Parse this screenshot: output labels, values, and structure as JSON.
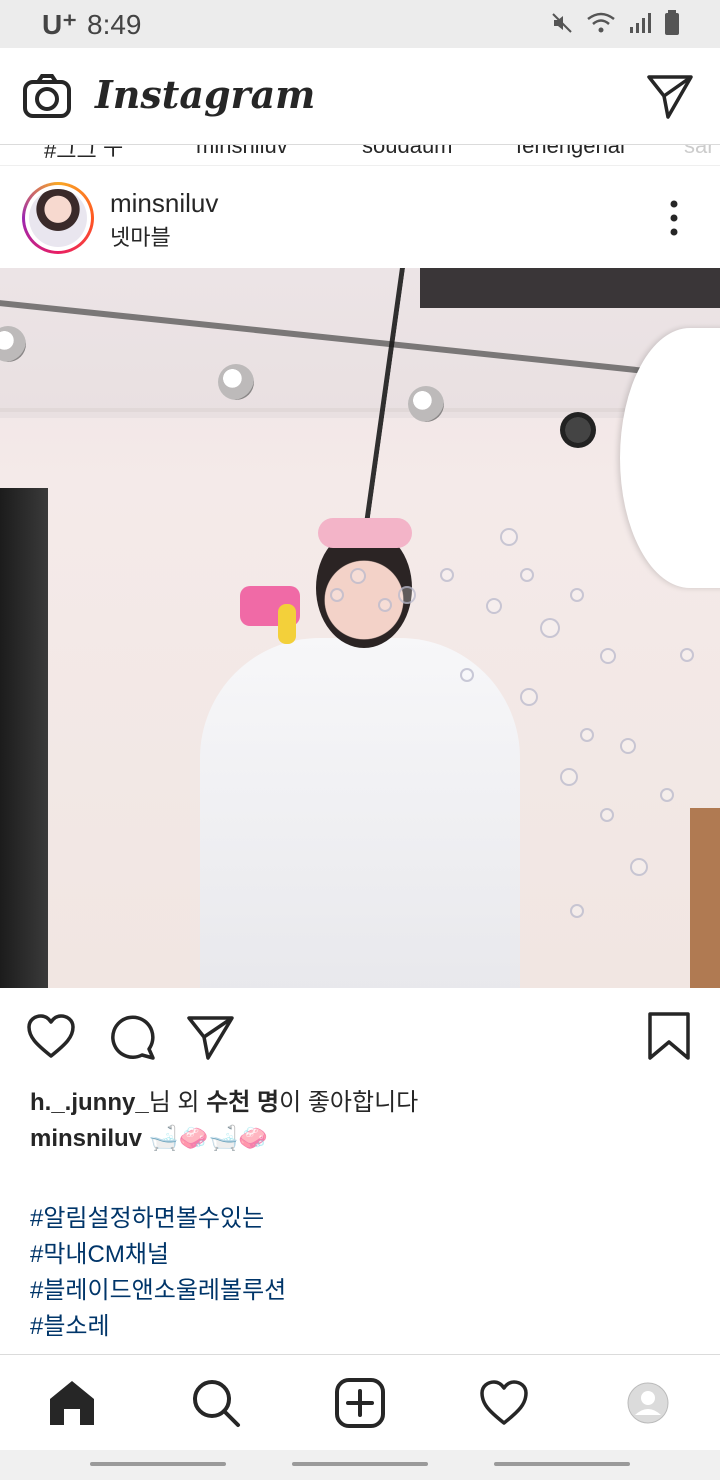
{
  "status_bar": {
    "carrier": "U⁺",
    "time": "8:49"
  },
  "header": {
    "logo": "Instagram"
  },
  "stories": [
    "#그그 ㅜ",
    "minsniluv",
    "soudaum",
    "fenengenal",
    "sar"
  ],
  "post": {
    "username": "minsniluv",
    "location": "넷마블",
    "likes": {
      "user": "h._.junny_",
      "mid": "님 외 ",
      "bold": "수천 명",
      "tail": "이 좋아합니다"
    },
    "caption_user": "minsniluv",
    "caption_emoji": "🛁🧼🛁🧼",
    "hashtags": [
      "#알림설정하면볼수있는",
      "#막내CM채널",
      "#블레이드앤소울레볼루션",
      "#블소레"
    ]
  },
  "colors": {
    "hashtag": "#003569",
    "text": "#262626"
  },
  "icons": [
    "camera-icon",
    "direct-send-icon",
    "more-options-icon",
    "heart-icon",
    "comment-icon",
    "share-icon",
    "bookmark-icon",
    "home-icon",
    "search-icon",
    "add-post-icon",
    "activity-heart-icon",
    "profile-icon"
  ]
}
